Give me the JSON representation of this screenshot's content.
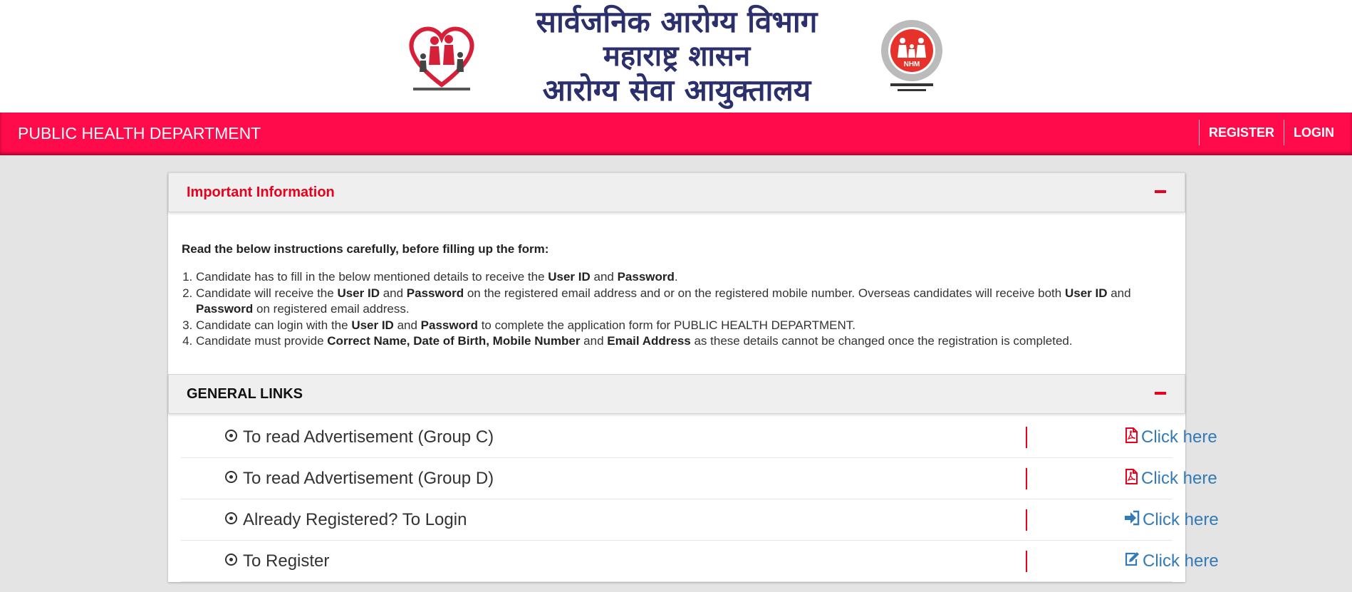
{
  "banner": {
    "line1": "सार्वजनिक आरोग्य विभाग",
    "line2": "महाराष्ट्र शासन",
    "line3": "आरोग्य सेवा आयुक्तालय",
    "left_logo_icon": "public-health-dept-logo",
    "right_logo_icon": "nhm-maharashtra-logo"
  },
  "navbar": {
    "brand": "PUBLIC HEALTH DEPARTMENT",
    "register": "REGISTER",
    "login": "LOGIN",
    "color": "#ff0a4a"
  },
  "info_panel": {
    "title": "Important Information",
    "lead": "Read the below instructions carefully, before filling up the form:",
    "items": [
      {
        "a": "Candidate has to fill in the below mentioned details to receive the ",
        "b1": "User ID",
        "c": " and ",
        "b2": "Password",
        "d": "."
      },
      {
        "a": "Candidate will receive the ",
        "b1": "User ID",
        "c": " and ",
        "b2": "Password",
        "d": " on the registered email address and or on the registered mobile number. Overseas candidates will receive both ",
        "b3": "User ID",
        "e": " and ",
        "b4": "Password",
        "f": " on registered email address."
      },
      {
        "a": "Candidate can login with the ",
        "b1": "User ID",
        "c": " and ",
        "b2": "Password",
        "d": " to complete the application form for PUBLIC HEALTH DEPARTMENT."
      },
      {
        "a": "Candidate must provide ",
        "b1": "Correct Name, Date of Birth, Mobile Number",
        "c": " and ",
        "b2": "Email Address",
        "d": " as these details cannot be changed once the registration is completed."
      }
    ]
  },
  "links_panel": {
    "title": "GENERAL LINKS",
    "rows": [
      {
        "label": "To read Advertisement (Group C)",
        "action": "Click here",
        "icon": "pdf-icon"
      },
      {
        "label": "To read Advertisement (Group D)",
        "action": "Click here",
        "icon": "pdf-icon"
      },
      {
        "label": "Already Registered? To Login",
        "action": "Click here",
        "icon": "sign-in-icon"
      },
      {
        "label": "To Register",
        "action": "Click here",
        "icon": "edit-icon"
      }
    ]
  }
}
